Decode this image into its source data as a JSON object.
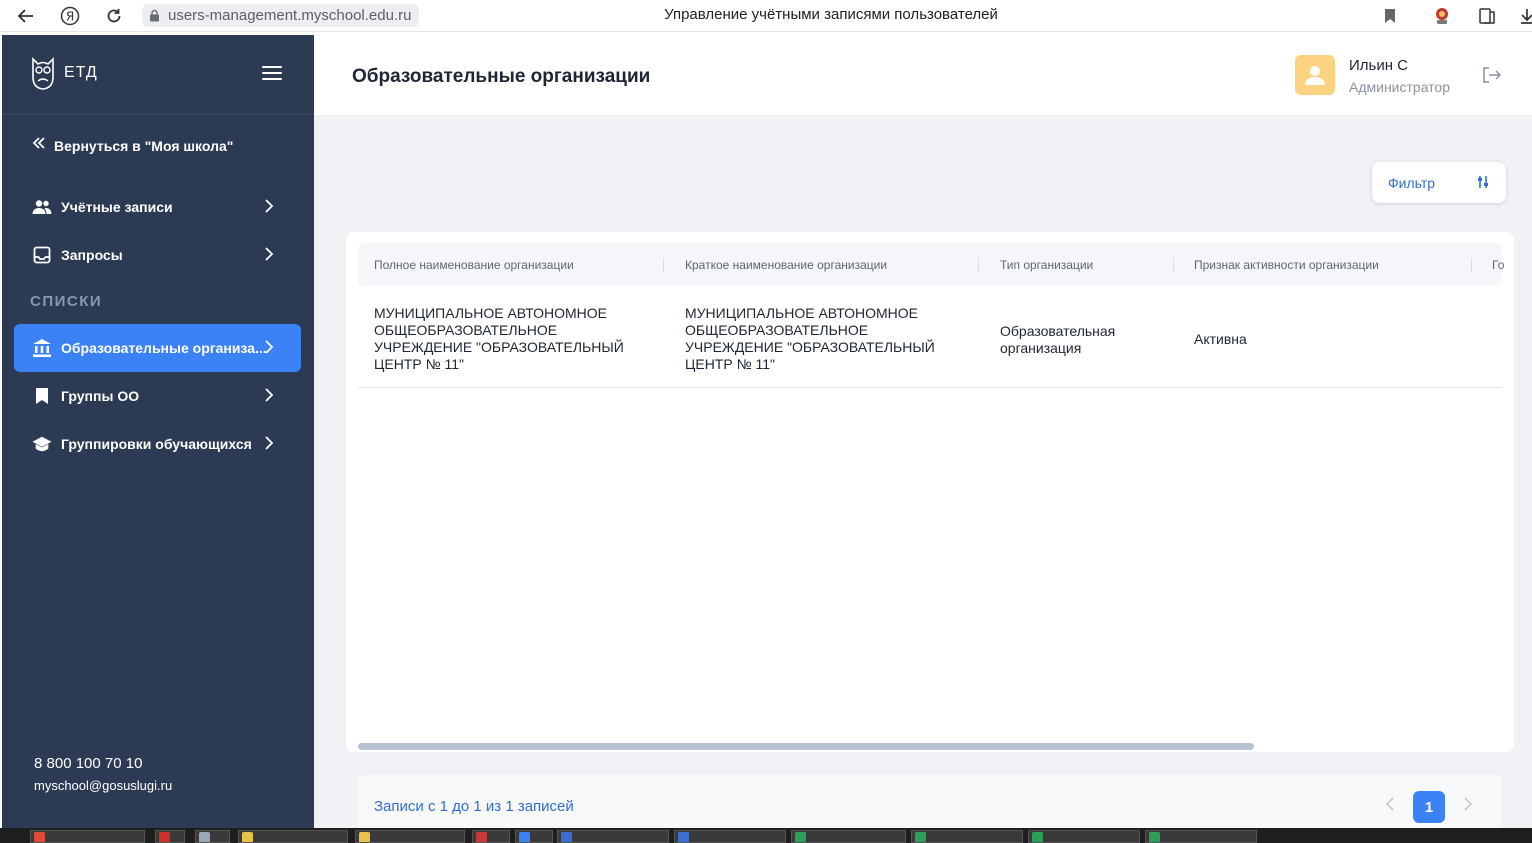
{
  "browser": {
    "url": "users-management.myschool.edu.ru",
    "tab_title": "Управление учётными записями пользователей",
    "yandex_glyph": "Я"
  },
  "sidebar": {
    "logo_text": "ЕТД",
    "back_link": "Вернуться в \"Моя школа\"",
    "items": [
      {
        "label": "Учётные записи",
        "icon": "people-icon"
      },
      {
        "label": "Запросы",
        "icon": "inbox-icon"
      },
      {
        "label": "Образовательные организа...",
        "icon": "institution-icon",
        "active": true
      },
      {
        "label": "Группы ОО",
        "icon": "bookmark-icon"
      },
      {
        "label": "Группировки обучающихся",
        "icon": "graduation-cap-icon"
      }
    ],
    "section_label": "СПИСКИ",
    "phone": "8 800 100 70 10",
    "email": "myschool@gosuslugi.ru"
  },
  "header": {
    "title": "Образовательные организации",
    "user_name": "Ильин С",
    "user_role": "Администратор"
  },
  "filter": {
    "label": "Фильтр"
  },
  "table": {
    "columns": [
      "Полное наименование организации",
      "Краткое наименование организации",
      "Тип организации",
      "Признак активности организации",
      "Го"
    ],
    "rows": [
      {
        "full_name": "МУНИЦИПАЛЬНОЕ АВТОНОМНОЕ ОБЩЕОБРАЗОВАТЕЛЬНОЕ УЧРЕЖДЕНИЕ \"ОБРАЗОВАТЕЛЬНЫЙ ЦЕНТР № 11\"",
        "short_name": "МУНИЦИПАЛЬНОЕ АВТОНОМНОЕ ОБЩЕОБРАЗОВАТЕЛЬНОЕ УЧРЕЖДЕНИЕ \"ОБРАЗОВАТЕЛЬНЫЙ ЦЕНТР № 11\"",
        "type": "Образовательная организация",
        "active": "Активна"
      }
    ]
  },
  "pagination": {
    "summary": "Записи с 1 до 1 из 1 записей",
    "current_page": "1"
  },
  "colors": {
    "sidebar_bg": "#2c3a54",
    "accent": "#3b82f6",
    "link": "#2f6fd4",
    "avatar_bg": "#fcd381"
  }
}
